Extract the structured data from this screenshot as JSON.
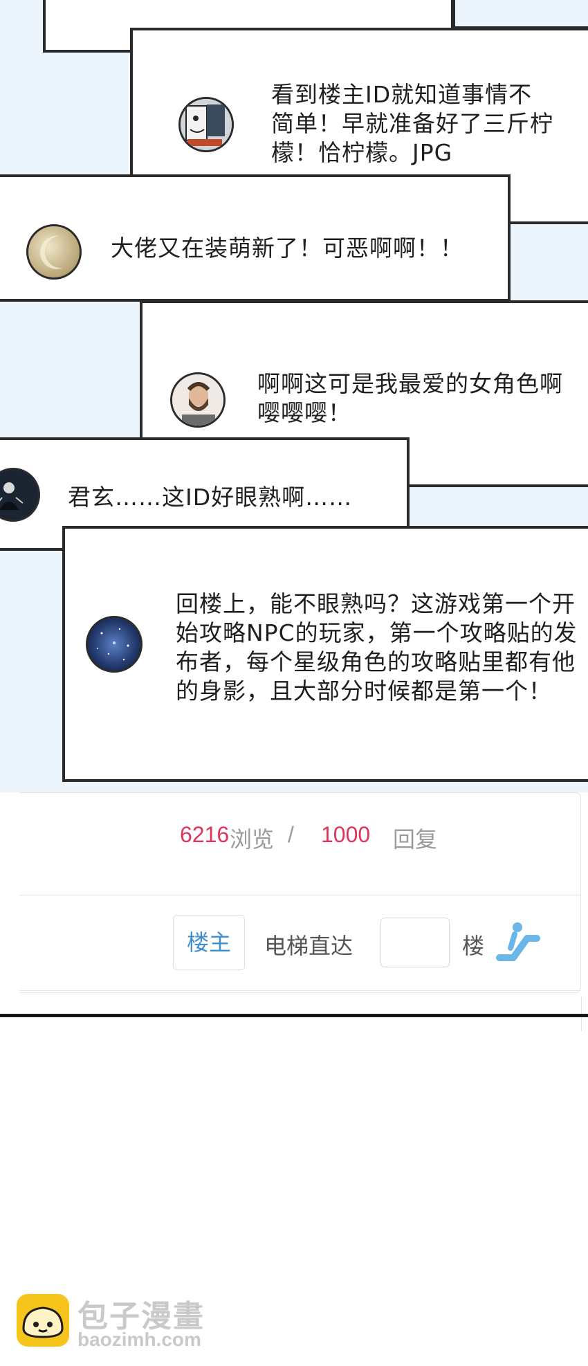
{
  "comments": [
    {
      "text": "看到楼主ID就知道事情不简单！早就准备好了三斤柠檬！恰柠檬。JPG",
      "avatar": "comic-face-avatar"
    },
    {
      "text": "大佬又在装萌新了！可恶啊啊！！",
      "avatar": "gold-moon-avatar"
    },
    {
      "text": "啊啊这可是我最爱的女角色啊嘤嘤嘤！",
      "avatar": "bearded-man-avatar"
    },
    {
      "text": "君玄……这ID好眼熟啊……",
      "avatar": "dark-figure-avatar"
    },
    {
      "text": "回楼上，能不眼熟吗？这游戏第一个开始攻略NPC的玩家，第一个攻略贴的发布者，每个星级角色的攻略贴里都有他的身影，且大部分时候都是第一个！",
      "avatar": "galaxy-avatar"
    }
  ],
  "stats": {
    "views_count": "6216",
    "views_label": "浏览",
    "separator": "/",
    "replies_count": "1000",
    "replies_label": "回复",
    "accent_color": "#e0345c"
  },
  "jump": {
    "owner_button": "楼主",
    "elevator_label": "电梯直达",
    "floor_input_value": "",
    "floor_suffix": "楼"
  },
  "watermark": {
    "brand": "包子漫畫",
    "site": "baozimh.com"
  }
}
